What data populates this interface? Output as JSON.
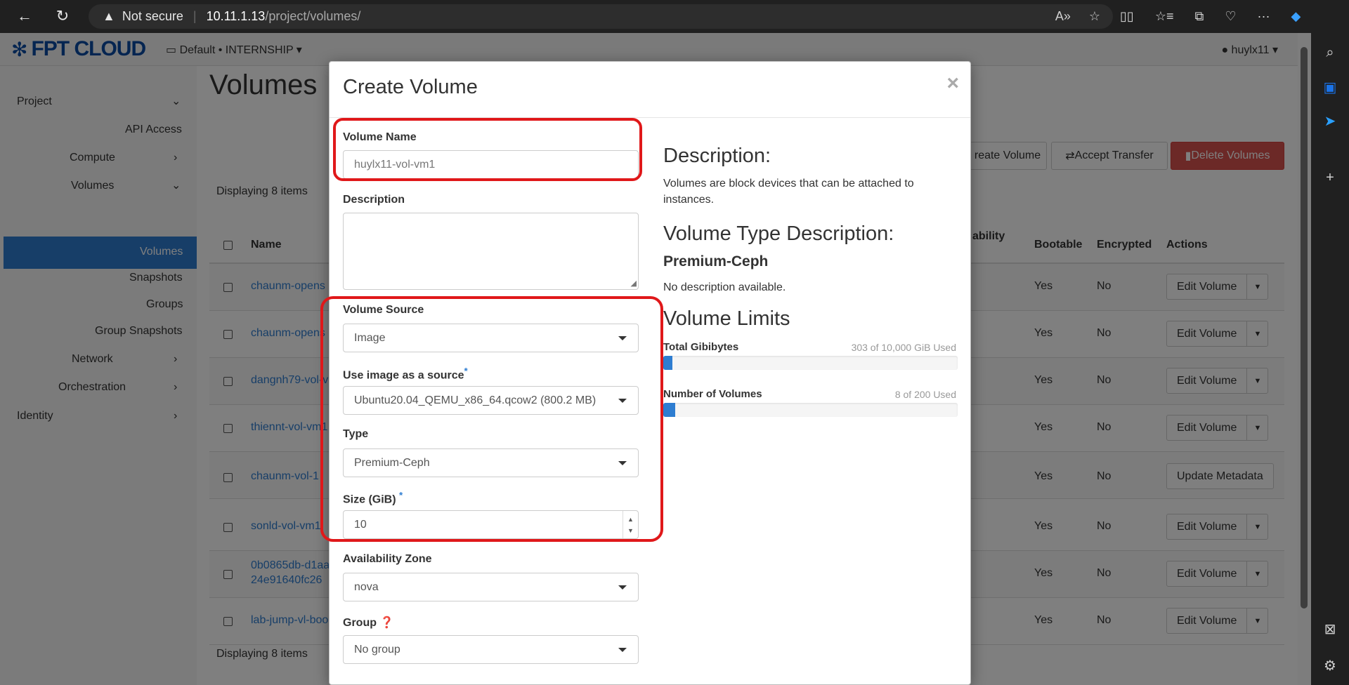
{
  "browser": {
    "security": "Not secure",
    "host": "10.11.1.13",
    "path": "/project/volumes/"
  },
  "header": {
    "logo": "FPT CLOUD",
    "project": "Default • INTERNSHIP",
    "user": "huylx11"
  },
  "sidebar": {
    "items": [
      {
        "label": "Project"
      },
      {
        "label": "API Access"
      },
      {
        "label": "Compute"
      },
      {
        "label": "Volumes"
      },
      {
        "label": "Volumes"
      },
      {
        "label": "Snapshots"
      },
      {
        "label": "Groups"
      },
      {
        "label": "Group Snapshots"
      },
      {
        "label": "Network"
      },
      {
        "label": "Orchestration"
      },
      {
        "label": "Identity"
      }
    ]
  },
  "main": {
    "title": "Volumes",
    "buttons": {
      "create": "reate Volume",
      "accept": "Accept Transfer",
      "delete": "Delete Volumes"
    },
    "displaying": "Displaying 8 items",
    "columns": [
      "Name",
      "ability",
      "Bootable",
      "Encrypted",
      "Actions"
    ],
    "rows": [
      {
        "name": "chaunm-opens",
        "bootable": "Yes",
        "encrypted": "No",
        "action": "Edit Volume"
      },
      {
        "name": "chaunm-opens",
        "bootable": "Yes",
        "encrypted": "No",
        "action": "Edit Volume"
      },
      {
        "name": "dangnh79-vol-v",
        "bootable": "Yes",
        "encrypted": "No",
        "action": "Edit Volume"
      },
      {
        "name": "thiennt-vol-vm1",
        "bootable": "Yes",
        "encrypted": "No",
        "action": "Edit Volume"
      },
      {
        "name": "chaunm-vol-1",
        "bootable": "Yes",
        "encrypted": "No",
        "action": "Update Metadata"
      },
      {
        "name": "sonld-vol-vm1",
        "bootable": "Yes",
        "encrypted": "No",
        "action": "Edit Volume"
      },
      {
        "name": "0b0865db-d1aa",
        "name2": "24e91640fc26",
        "bootable": "Yes",
        "encrypted": "No",
        "action": "Edit Volume"
      },
      {
        "name": "lab-jump-vl-boo",
        "bootable": "Yes",
        "encrypted": "No",
        "action": "Edit Volume"
      }
    ]
  },
  "modal": {
    "title": "Create Volume",
    "close": "×",
    "fields": {
      "volume_name_label": "Volume Name",
      "volume_name_value": "huylx11-vol-vm1",
      "description_label": "Description",
      "source_label": "Volume Source",
      "source_value": "Image",
      "image_label": "Use image as a source",
      "image_value": "Ubuntu20.04_QEMU_x86_64.qcow2 (800.2 MB)",
      "type_label": "Type",
      "type_value": "Premium-Ceph",
      "size_label": "Size (GiB)",
      "size_value": "10",
      "az_label": "Availability Zone",
      "az_value": "nova",
      "group_label": "Group",
      "group_value": "No group"
    },
    "info": {
      "desc_heading": "Description:",
      "desc_text": "Volumes are block devices that can be attached to instances.",
      "type_heading": "Volume Type Description:",
      "type_name": "Premium-Ceph",
      "type_text": "No description available.",
      "limits_heading": "Volume Limits",
      "limit1_label": "Total Gibibytes",
      "limit1_used": "303 of 10,000 GiB Used",
      "limit1_fraction": 0.0303,
      "limit2_label": "Number of Volumes",
      "limit2_used": "8 of 200 Used",
      "limit2_fraction": 0.04
    }
  },
  "annotation_color": "#e0181a",
  "accent_color": "#2e7dd1"
}
